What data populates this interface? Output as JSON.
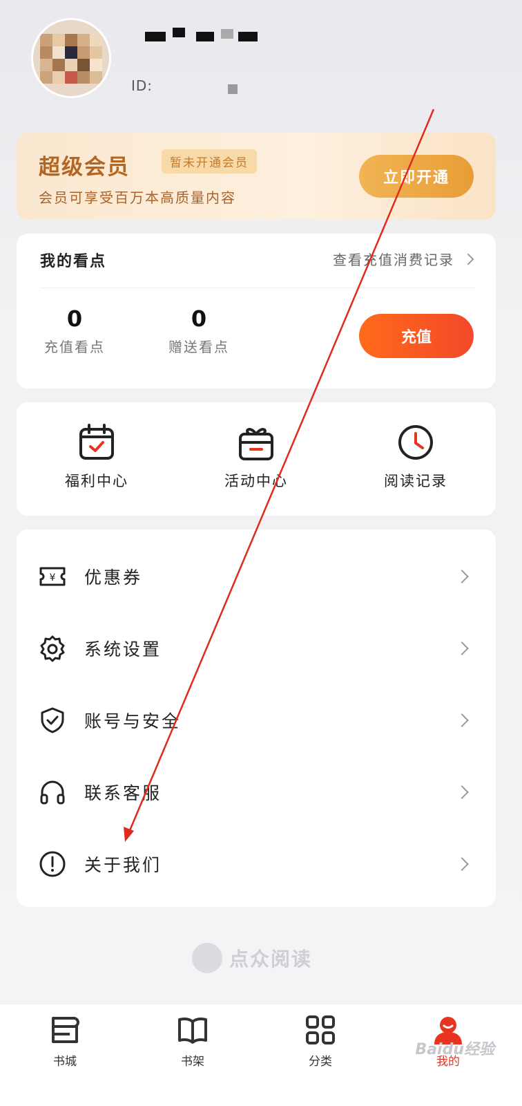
{
  "profile": {
    "id_label": "ID:"
  },
  "vip": {
    "title": "超级会员",
    "badge": "暂未开通会员",
    "description": "会员可享受百万本高质量内容",
    "button": "立即开通"
  },
  "points": {
    "title": "我的看点",
    "history_link": "查看充值消费记录",
    "stats": [
      {
        "value": "0",
        "label": "充值看点"
      },
      {
        "value": "0",
        "label": "赠送看点"
      }
    ],
    "recharge_button": "充值"
  },
  "quick_links": [
    {
      "label": "福利中心",
      "icon": "calendar-check-icon"
    },
    {
      "label": "活动中心",
      "icon": "gift-icon"
    },
    {
      "label": "阅读记录",
      "icon": "clock-icon"
    }
  ],
  "menu": [
    {
      "label": "优惠券",
      "icon": "coupon-icon"
    },
    {
      "label": "系统设置",
      "icon": "gear-icon"
    },
    {
      "label": "账号与安全",
      "icon": "shield-icon"
    },
    {
      "label": "联系客服",
      "icon": "headphones-icon"
    },
    {
      "label": "关于我们",
      "icon": "info-icon"
    }
  ],
  "brand": {
    "name": "点众阅读"
  },
  "tabbar": [
    {
      "label": "书城",
      "icon": "bookstore-icon"
    },
    {
      "label": "书架",
      "icon": "bookshelf-icon"
    },
    {
      "label": "分类",
      "icon": "category-grid-icon"
    },
    {
      "label": "我的",
      "icon": "profile-icon",
      "active": true
    }
  ],
  "watermark": "Baidu经验",
  "colors": {
    "accent": "#f2492a",
    "vip_gold": "#e89d36",
    "annotation_arrow": "#e02a1c"
  }
}
